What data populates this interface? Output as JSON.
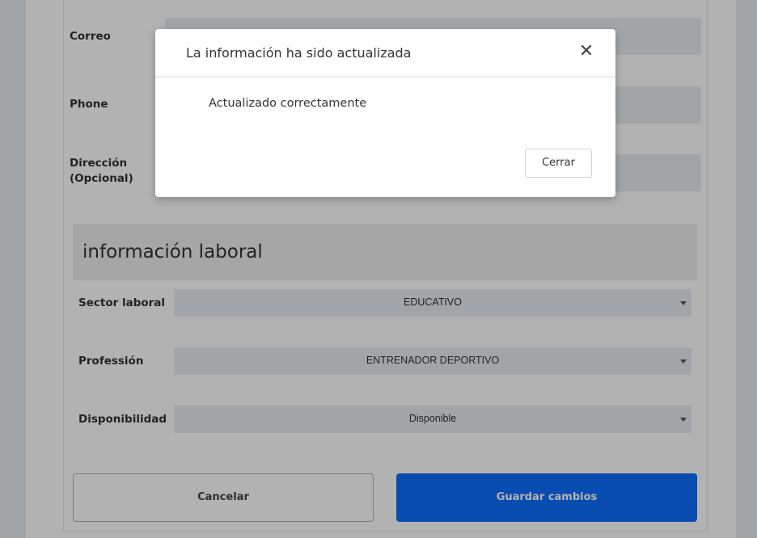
{
  "form": {
    "email_label": "Correo",
    "phone_label": "Phone",
    "address_label_line1": "Dirección",
    "address_label_line2": "(Opcional)"
  },
  "work_info": {
    "section_title": "información laboral",
    "sector_label": "Sector laboral",
    "sector_value": "EDUCATIVO",
    "profession_label": "Professión",
    "profession_value": "ENTRENADOR DEPORTIVO",
    "availability_label": "Disponibilidad",
    "availability_value": "Disponible"
  },
  "actions": {
    "cancel_label": "Cancelar",
    "save_label": "Guardar cambios"
  },
  "modal": {
    "title": "La información ha sido actualizada",
    "close_icon": "close-icon",
    "message": "Actualizado correctamente",
    "close_button_label": "Cerrar"
  },
  "colors": {
    "primary": "#0d6efd",
    "input_bg": "#e9ecef",
    "backdrop": "rgba(0,0,0,0.30)"
  }
}
